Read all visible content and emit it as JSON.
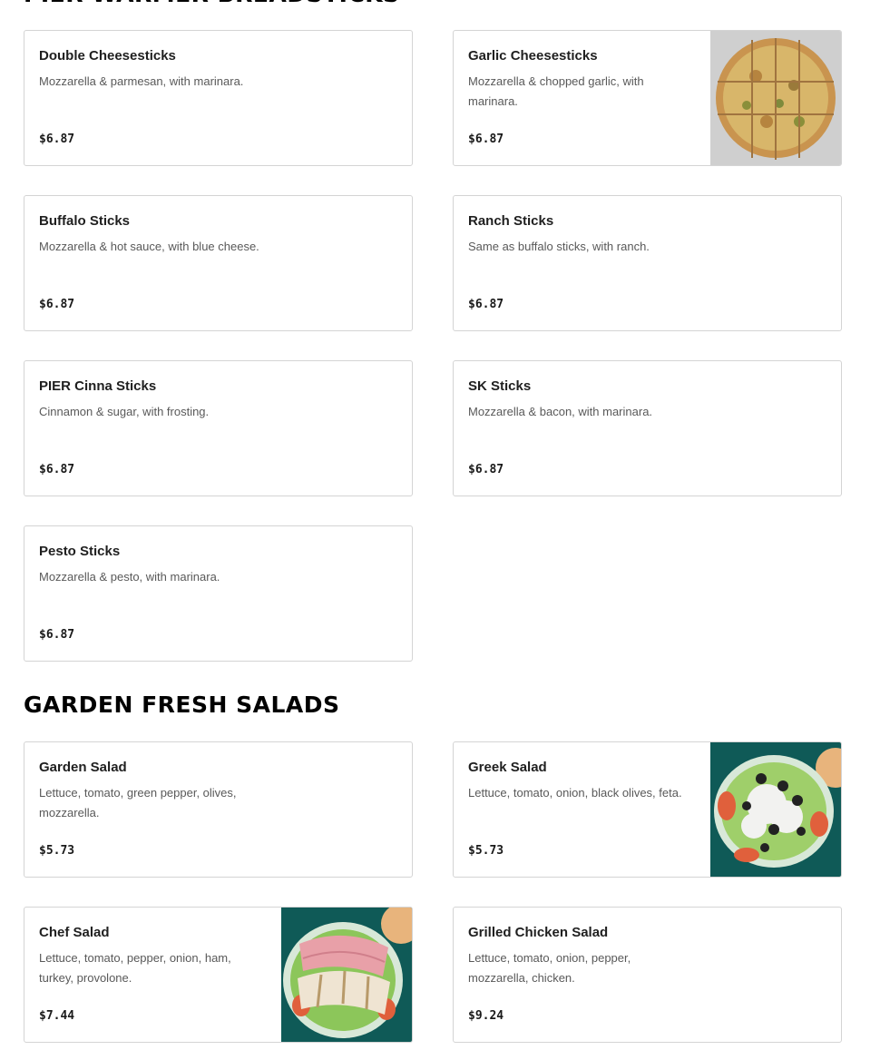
{
  "sections": [
    {
      "title": "PIER WARMER BREADSTICKS",
      "items": [
        {
          "name": "Double Cheesesticks",
          "description": "Mozzarella & parmesan, with marinara.",
          "price": "$6.87"
        },
        {
          "name": "Garlic Cheesesticks",
          "description": "Mozzarella & chopped garlic, with marinara.",
          "price": "$6.87",
          "image": "garlic-cheesesticks-photo"
        },
        {
          "name": "Buffalo Sticks",
          "description": "Mozzarella & hot sauce, with blue cheese.",
          "price": "$6.87"
        },
        {
          "name": "Ranch Sticks",
          "description": "Same as buffalo sticks, with ranch.",
          "price": "$6.87"
        },
        {
          "name": "PIER Cinna Sticks",
          "description": "Cinnamon & sugar, with frosting.",
          "price": "$6.87"
        },
        {
          "name": "SK Sticks",
          "description": "Mozzarella & bacon, with marinara.",
          "price": "$6.87"
        },
        {
          "name": "Pesto Sticks",
          "description": "Mozzarella & pesto, with marinara.",
          "price": "$6.87"
        }
      ]
    },
    {
      "title": "GARDEN FRESH SALADS",
      "items": [
        {
          "name": "Garden Salad",
          "description": "Lettuce, tomato, green pepper, olives, mozzarella.",
          "price": "$5.73"
        },
        {
          "name": "Greek Salad",
          "description": "Lettuce, tomato, onion, black olives, feta.",
          "price": "$5.73",
          "image": "greek-salad-photo"
        },
        {
          "name": "Chef Salad",
          "description": "Lettuce, tomato, pepper, onion, ham, turkey, provolone.",
          "price": "$7.44",
          "image": "chef-salad-photo"
        },
        {
          "name": "Grilled Chicken Salad",
          "description": "Lettuce, tomato, onion, pepper, mozzarella, chicken.",
          "price": "$9.24"
        }
      ]
    }
  ]
}
